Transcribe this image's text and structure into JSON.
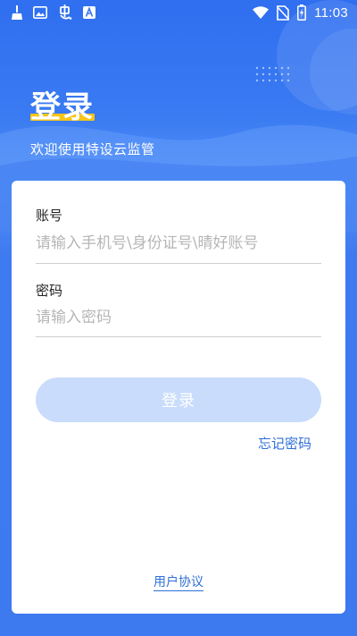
{
  "status_bar": {
    "time": "11:03",
    "left_icons": [
      "broom-icon",
      "image-icon",
      "insect-icon",
      "text-a-icon"
    ],
    "right_icons": [
      "wifi-icon",
      "no-sim-icon",
      "battery-charging-icon"
    ]
  },
  "hero": {
    "title": "登录",
    "subtitle": "欢迎使用特设云监管"
  },
  "form": {
    "account_label": "账号",
    "account_placeholder": "请输入手机号\\身份证号\\晴好账号",
    "account_value": "",
    "password_label": "密码",
    "password_placeholder": "请输入密码",
    "password_value": ""
  },
  "actions": {
    "login_label": "登录",
    "forgot_password": "忘记密码",
    "user_agreement": "用户协议"
  },
  "colors": {
    "primary": "#3f7bf0",
    "accent_underline": "#f5c518",
    "link": "#2f6fd8",
    "button_disabled": "#c9dcfb"
  }
}
